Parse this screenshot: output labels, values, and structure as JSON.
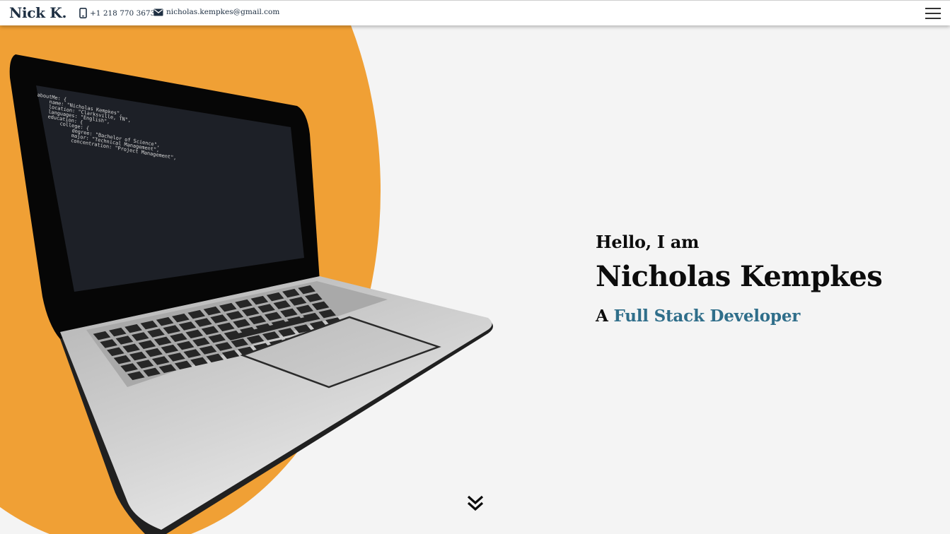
{
  "navbar": {
    "brand": "Nick K.",
    "phone": "+1 218 770 3673",
    "email": "nicholas.kempkes@gmail.com",
    "icons": {
      "phone": "phone-icon",
      "email": "mail-icon",
      "menu": "hamburger-menu-icon"
    }
  },
  "hero": {
    "greeting": "Hello, I am",
    "name": "Nicholas Kempkes",
    "role_prefix": "A",
    "role_title": "Full Stack Developer",
    "scroll_icon": "double-chevron-down-icon"
  },
  "laptop_screen": {
    "code_lines": [
      "aboutMe: {",
      "name: \"Nicholas Kempkes\",",
      "location: \"Clarksville, TN\",",
      "languages: \"English\",",
      "education: {",
      "college: {",
      "degree: \"Bachelor of Science\",",
      "major: \"Technical Management\",",
      "concentration: \"Project Management\","
    ]
  },
  "colors": {
    "background": "#f4f4f4",
    "accent_orange": "#f0a035",
    "navy": "#1e2f42",
    "highlight_blue": "#2f6e8a",
    "text": "#0c0c0c"
  }
}
